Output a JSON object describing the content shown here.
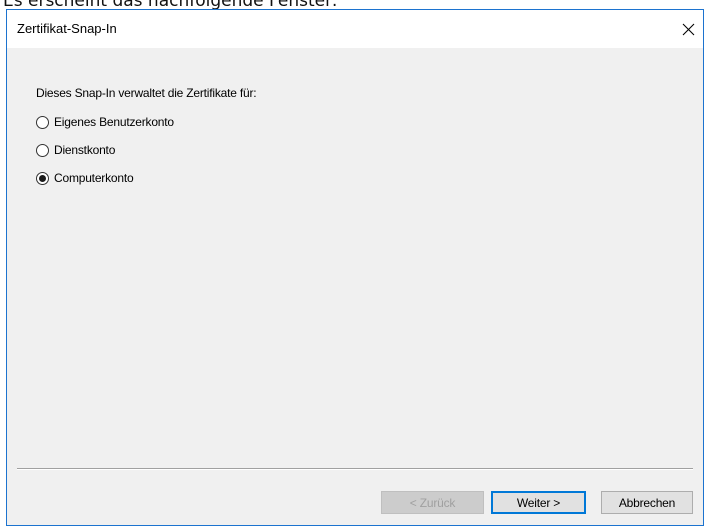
{
  "doc_intro": "Es erscheint das nachfolgende Fenster:",
  "dialog": {
    "title": "Zertifikat-Snap-In",
    "close_label": "×",
    "prompt": "Dieses Snap-In verwaltet die Zertifikate für:",
    "options": [
      {
        "label": "Eigenes Benutzerkonto",
        "selected": false
      },
      {
        "label": "Dienstkonto",
        "selected": false
      },
      {
        "label": "Computerkonto",
        "selected": true
      }
    ],
    "buttons": {
      "back": "< Zurück",
      "back_enabled": false,
      "next": "Weiter >",
      "cancel": "Abbrechen"
    }
  },
  "colors": {
    "window_border": "#1c73cf",
    "default_button_border": "#0078d7",
    "dialog_background": "#f0f0f0"
  }
}
